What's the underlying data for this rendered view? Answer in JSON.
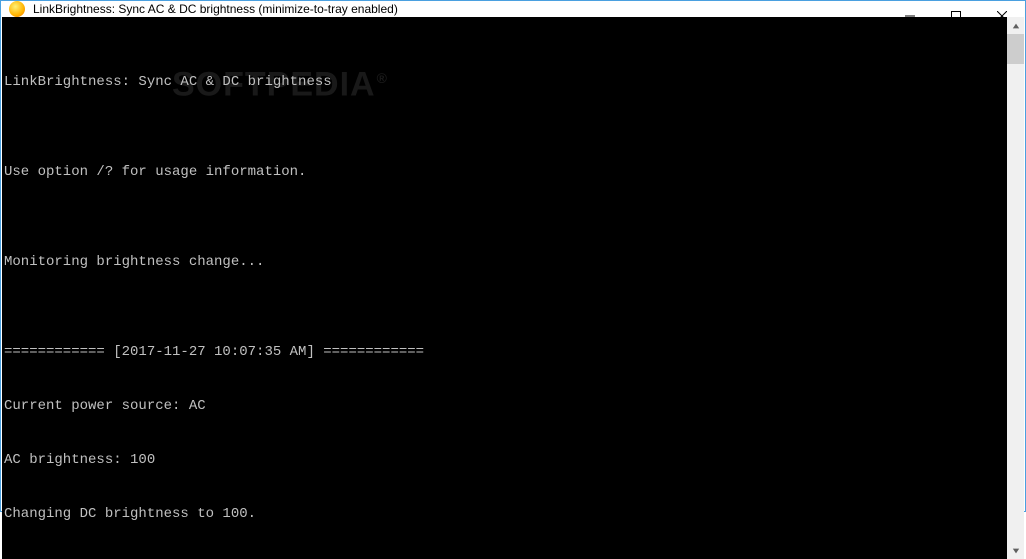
{
  "titlebar": {
    "title": "LinkBrightness: Sync AC & DC brightness   (minimize-to-tray enabled)"
  },
  "watermark": "SOFTPEDIA",
  "console": {
    "lines": [
      "LinkBrightness: Sync AC & DC brightness",
      "",
      "Use option /? for usage information.",
      "",
      "Monitoring brightness change...",
      "",
      "============ [2017-11-27 10:07:35 AM] ============",
      "Current power source: AC",
      "AC brightness: 100",
      "Changing DC brightness to 100."
    ]
  }
}
